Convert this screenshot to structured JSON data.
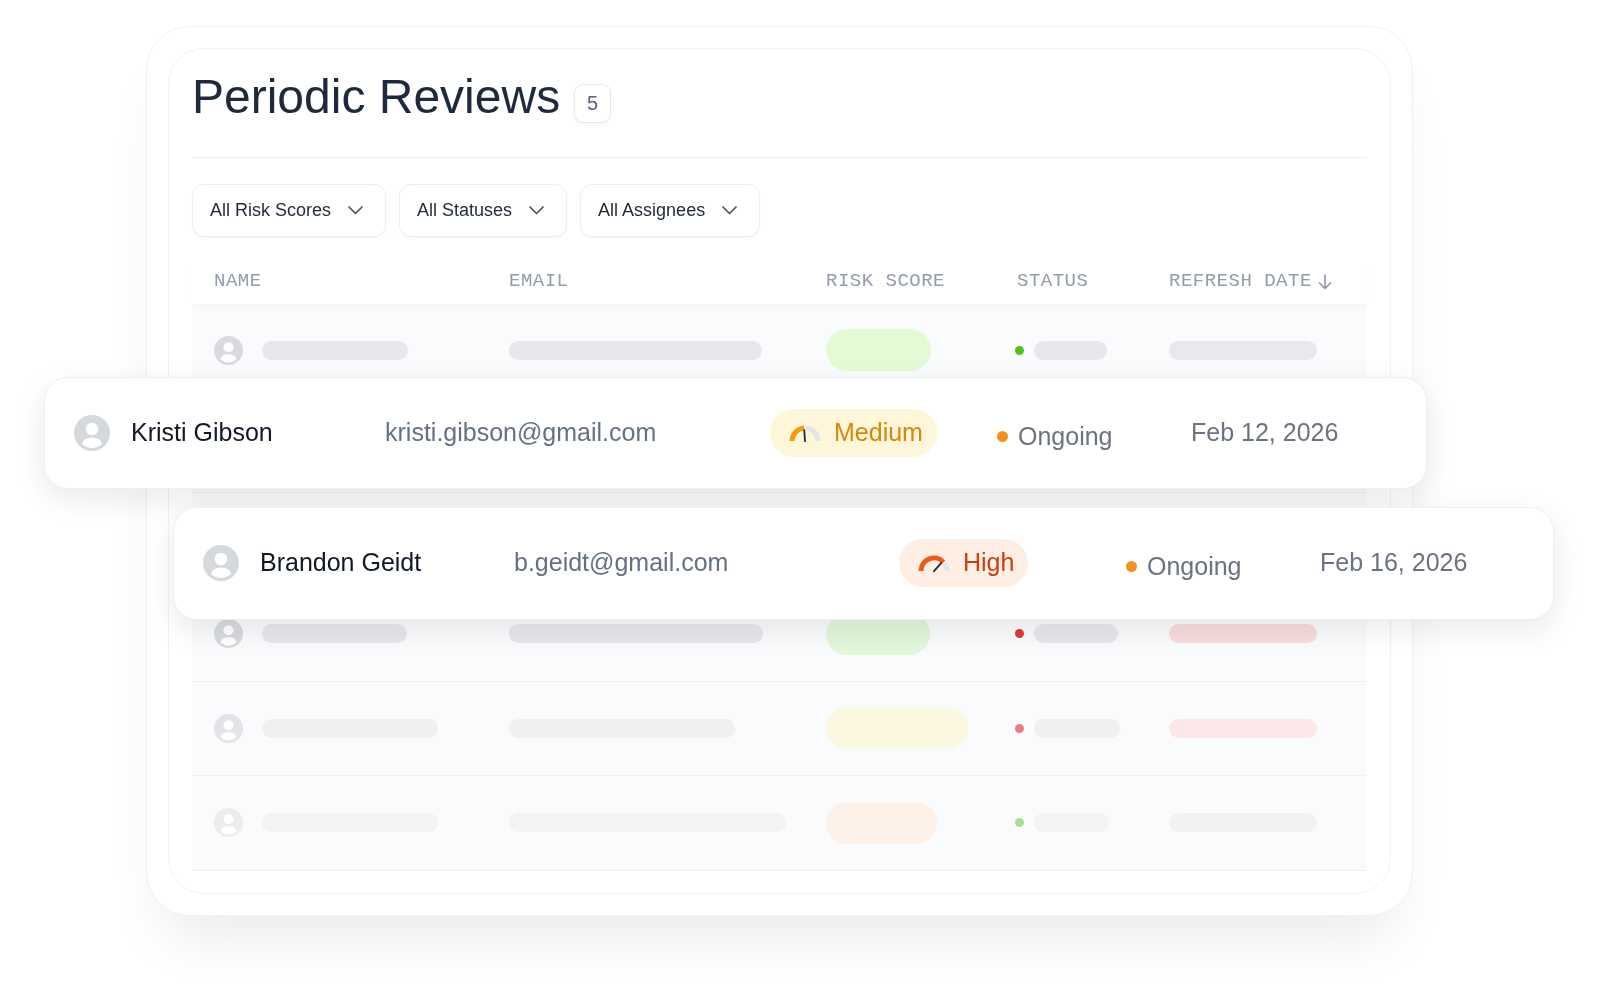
{
  "title": "Periodic Reviews",
  "count": "5",
  "filters": [
    {
      "label": "All Risk Scores"
    },
    {
      "label": "All Statuses"
    },
    {
      "label": "All Assignees"
    }
  ],
  "table": {
    "columns": [
      {
        "label": "NAME",
        "sorted": false
      },
      {
        "label": "EMAIL",
        "sorted": false
      },
      {
        "label": "RISK SCORE",
        "sorted": false
      },
      {
        "label": "STATUS",
        "sorted": false
      },
      {
        "label": "REFRESH DATE",
        "sorted": true
      }
    ],
    "rows": [
      {
        "kind": "placeholder",
        "risk_pill": {
          "color": "#e3fbd5"
        },
        "status_dot": {
          "color": "#4cc418"
        },
        "date_bar": {
          "color": "#e8e9ec"
        }
      },
      {
        "kind": "record",
        "name": "Kristi Gibson",
        "email": "kristi.gibson@gmail.com",
        "risk": {
          "kind": "medium",
          "label": "Medium"
        },
        "status": {
          "label": "Ongoing",
          "color": "#f5921e"
        },
        "date": "Feb 12, 2026"
      },
      {
        "kind": "record",
        "name": "Brandon Geidt",
        "email": "b.geidt@gmail.com",
        "risk": {
          "kind": "high",
          "label": "High"
        },
        "status": {
          "label": "Ongoing",
          "color": "#f5921e"
        },
        "date": "Feb 16, 2026"
      },
      {
        "kind": "placeholder",
        "risk_pill": {
          "color": "#e3f7da"
        },
        "status_dot": {
          "color": "#e5383b"
        },
        "date_bar": {
          "color": "#f9dcdc"
        }
      },
      {
        "kind": "placeholder",
        "risk_pill": {
          "color": "#fcf8df"
        },
        "status_dot": {
          "color": "#ec7b82"
        },
        "date_bar": {
          "color": "#fde7e9"
        }
      },
      {
        "kind": "placeholder",
        "risk_pill": {
          "color": "#fdf1e8"
        },
        "status_dot": {
          "color": "#a9de90"
        },
        "date_bar": {
          "color": "#f1f2f4"
        }
      }
    ]
  }
}
